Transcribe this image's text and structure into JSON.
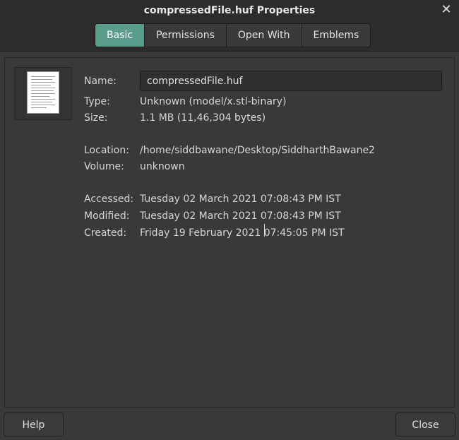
{
  "window": {
    "title": "compressedFile.huf Properties"
  },
  "tabs": [
    {
      "label": "Basic",
      "active": true
    },
    {
      "label": "Permissions",
      "active": false
    },
    {
      "label": "Open With",
      "active": false
    },
    {
      "label": "Emblems",
      "active": false
    }
  ],
  "basic": {
    "name_label": "Name:",
    "name_value": "compressedFile.huf",
    "type_label": "Type:",
    "type_value": "Unknown (model/x.stl-binary)",
    "size_label": "Size:",
    "size_value": "1.1 MB (11,46,304 bytes)",
    "location_label": "Location:",
    "location_value": "/home/siddbawane/Desktop/SiddharthBawane2",
    "volume_label": "Volume:",
    "volume_value": "unknown",
    "accessed_label": "Accessed:",
    "accessed_value": "Tuesday 02 March 2021 07:08:43 PM IST",
    "modified_label": "Modified:",
    "modified_value": "Tuesday 02 March 2021 07:08:43 PM IST",
    "created_label": "Created:",
    "created_value": "Friday 19 February 2021 07:45:05 PM IST"
  },
  "icons": {
    "file": "document-icon",
    "close": "close-icon"
  },
  "footer": {
    "help_label": "Help",
    "close_label": "Close"
  },
  "colors": {
    "accent": "#5a9c8a",
    "background": "#393939",
    "header": "#2c2c2c"
  }
}
